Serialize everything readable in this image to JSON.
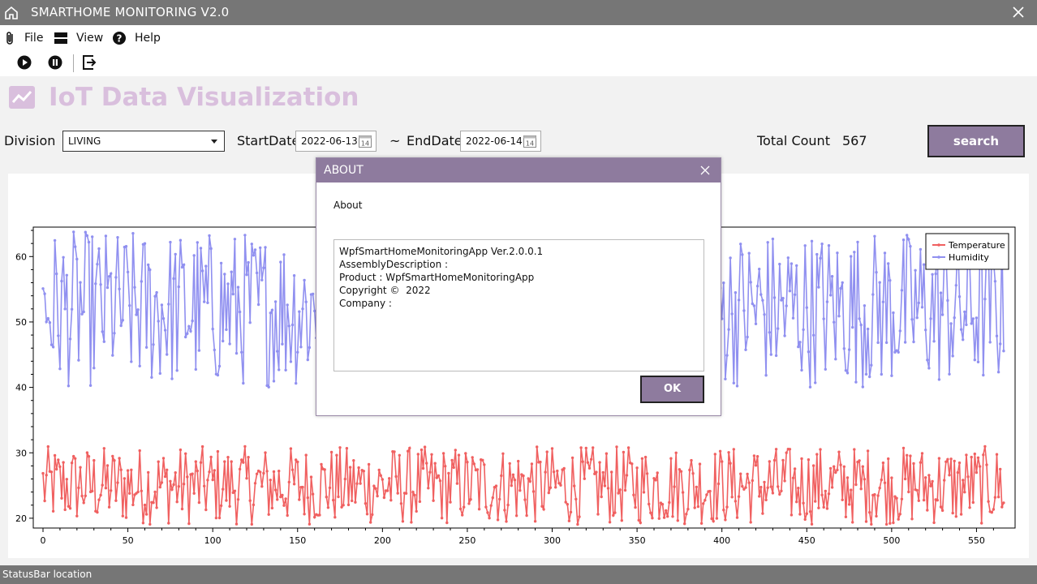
{
  "window": {
    "title": "SMARTHOME MONITORING V2.0"
  },
  "menu": {
    "file": "File",
    "view": "View",
    "help": "Help"
  },
  "heading": {
    "title": "IoT Data Visualization"
  },
  "filters": {
    "division_label": "Division",
    "division_value": "LIVING",
    "start_label": "StartDate",
    "start_value": "2022-06-13",
    "tilde": "~",
    "end_label": "EndDate",
    "end_value": "2022-06-14",
    "total_label": "Total Count",
    "total_value": "567",
    "search_label": "search"
  },
  "status": {
    "text": "StatusBar location"
  },
  "dialog": {
    "title": "ABOUT",
    "about_label": "About",
    "lines": [
      "WpfSmartHomeMonitoringApp Ver.2.0.0.1",
      "",
      "AssemblyDescription :",
      "Product : WpfSmartHomeMonitoringApp",
      "Copyright ©  2022",
      "Company :"
    ],
    "ok_label": "OK"
  },
  "chart_data": {
    "type": "line",
    "xlim": [
      0,
      567
    ],
    "ylim": [
      18.5,
      64.5
    ],
    "x_ticks": [
      0,
      50,
      100,
      150,
      200,
      250,
      300,
      350,
      400,
      450,
      500,
      550
    ],
    "y_ticks": [
      20,
      30,
      40,
      50,
      60
    ],
    "legend_position": "top-right",
    "series": [
      {
        "name": "Temperature",
        "color": "#f06060",
        "range": [
          19,
          31
        ],
        "count": 567
      },
      {
        "name": "Humidity",
        "color": "#9090f0",
        "range": [
          40,
          64
        ],
        "count": 567
      }
    ]
  }
}
